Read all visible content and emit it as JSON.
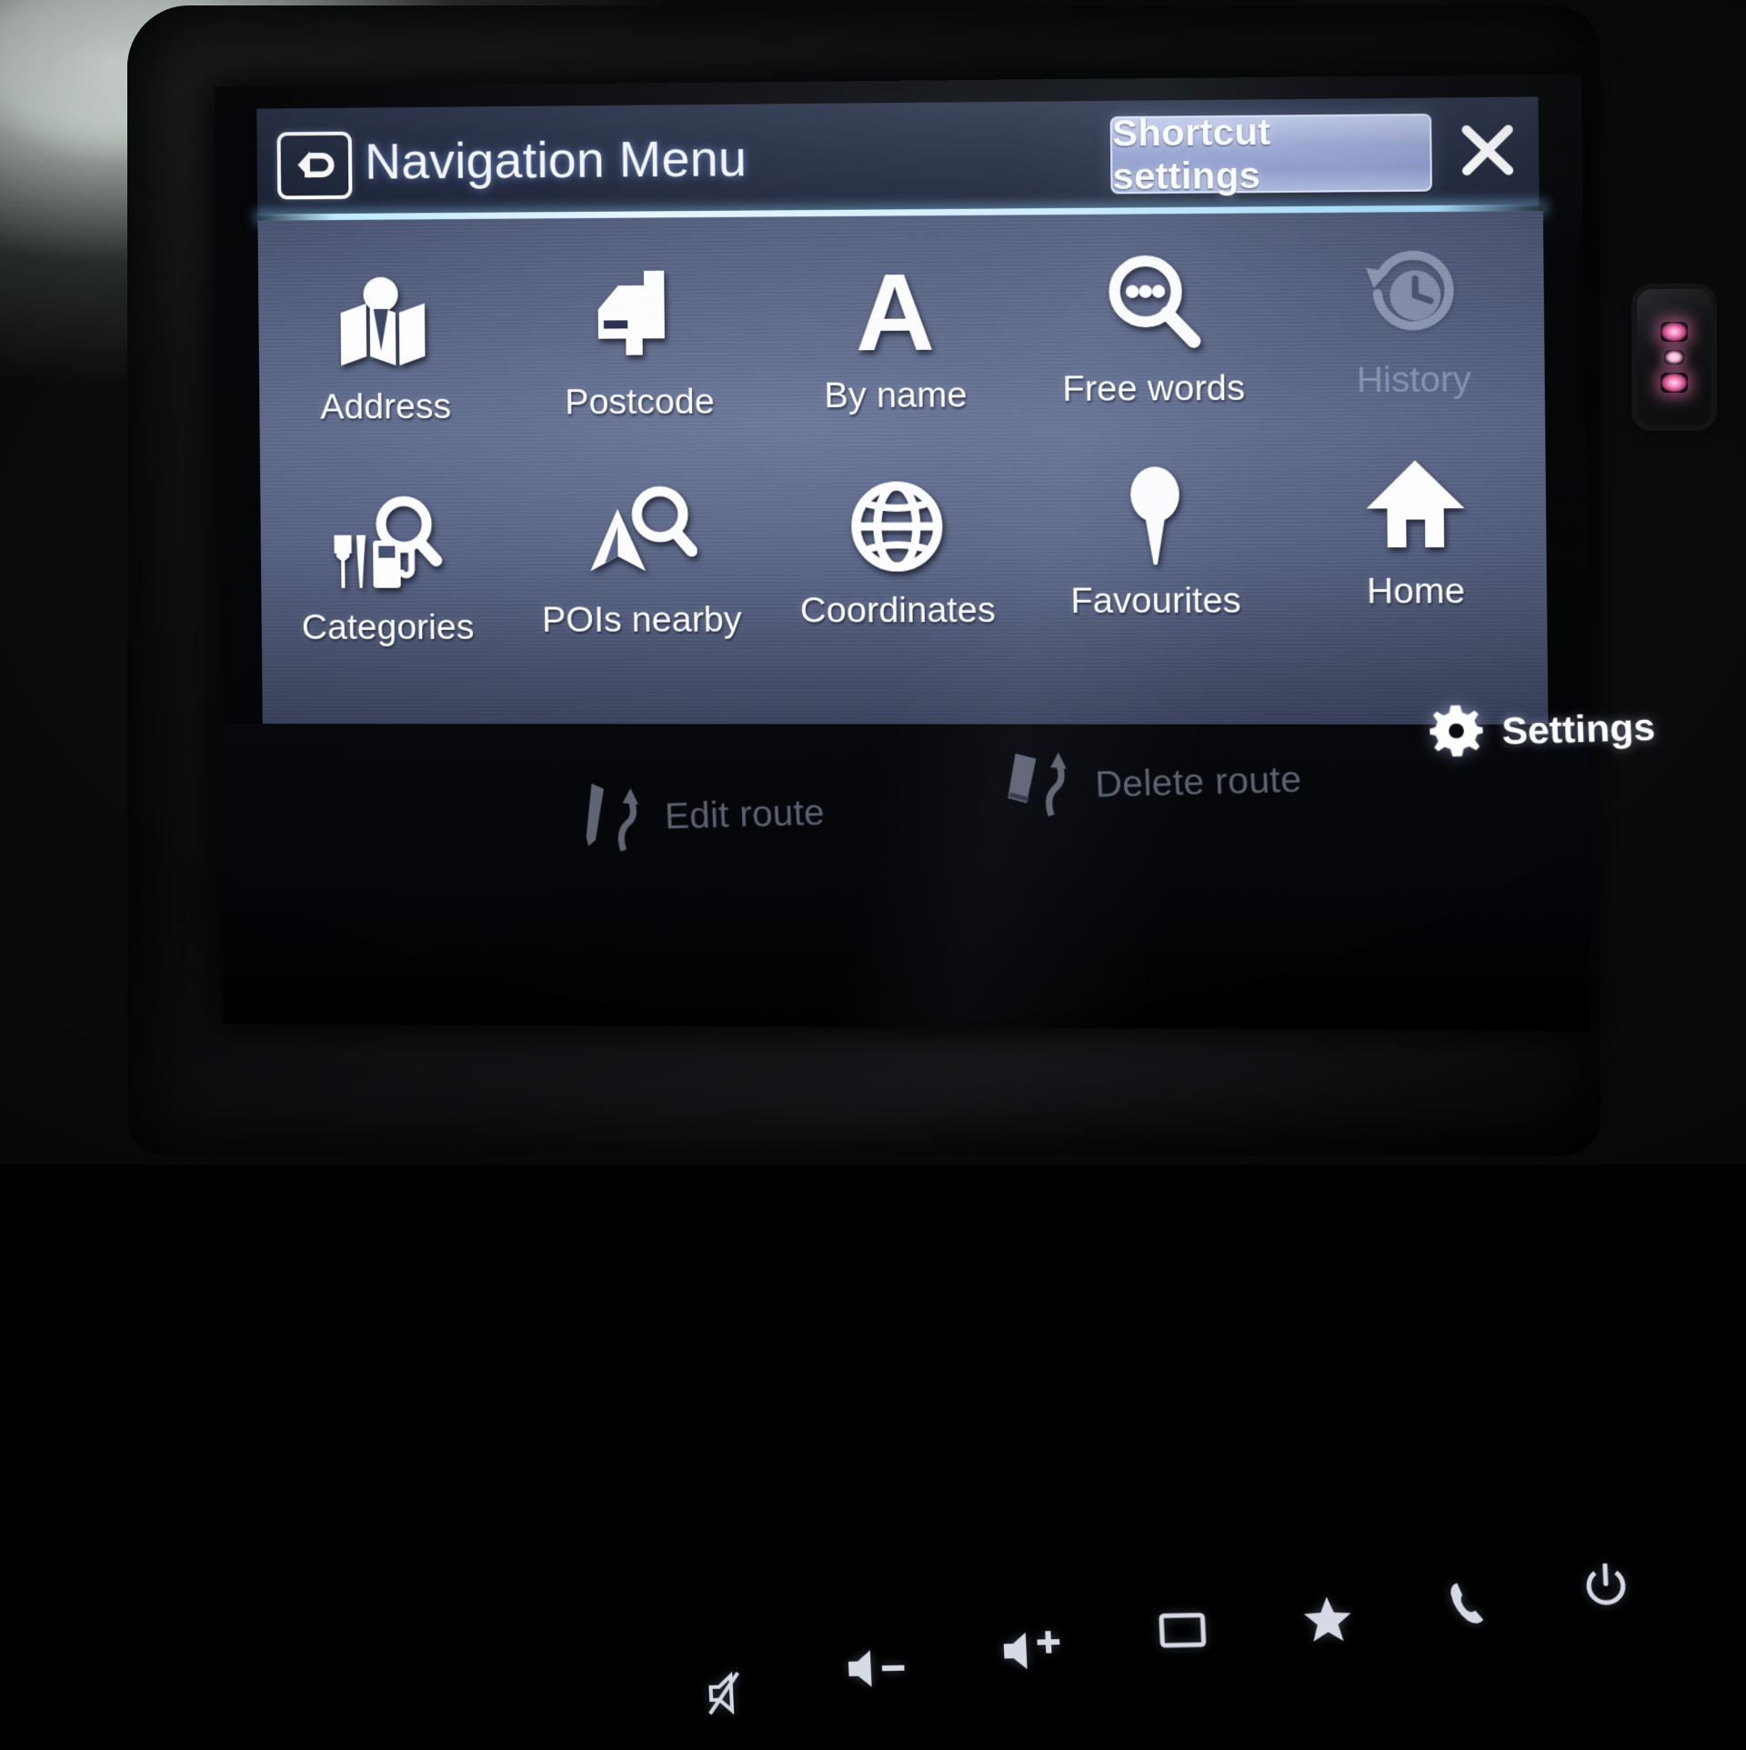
{
  "device": {
    "type": "car-infotainment-touchscreen",
    "accent_color": "#bfeaff",
    "panel_color": "#556081",
    "text_color": "#ffffff",
    "disabled_color": "#9aa3bd"
  },
  "header": {
    "back_icon": "back-arrow-icon",
    "title": "Navigation Menu",
    "shortcut_label": "Shortcut settings",
    "close_icon": "close-icon"
  },
  "menu": {
    "row1": [
      {
        "label": "Address",
        "icon": "map-person-icon",
        "enabled": true
      },
      {
        "label": "Postcode",
        "icon": "mailbox-icon",
        "enabled": true
      },
      {
        "label": "By name",
        "icon": "letter-a-icon",
        "enabled": true
      },
      {
        "label": "Free words",
        "icon": "magnifier-dots-icon",
        "enabled": true
      },
      {
        "label": "History",
        "icon": "clock-history-icon",
        "enabled": false
      }
    ],
    "row2": [
      {
        "label": "Categories",
        "icon": "cutlery-fuel-magnifier-icon",
        "enabled": true
      },
      {
        "label": "POIs nearby",
        "icon": "navarrow-magnifier-icon",
        "enabled": true
      },
      {
        "label": "Coordinates",
        "icon": "globe-icon",
        "enabled": true
      },
      {
        "label": "Favourites",
        "icon": "map-pin-icon",
        "enabled": true
      },
      {
        "label": "Home",
        "icon": "house-icon",
        "enabled": true
      }
    ]
  },
  "bottom_bar": {
    "edit_route": {
      "label": "Edit route",
      "icon": "pencil-route-icon",
      "enabled": false
    },
    "delete_route": {
      "label": "Delete route",
      "icon": "eraser-route-icon",
      "enabled": false
    },
    "settings": {
      "label": "Settings",
      "icon": "gear-icon",
      "enabled": true
    }
  },
  "hardware_buttons": [
    {
      "name": "mute",
      "icon": "speaker-mute-icon"
    },
    {
      "name": "volume-down",
      "icon": "speaker-minus-icon"
    },
    {
      "name": "volume-up",
      "icon": "speaker-plus-icon"
    },
    {
      "name": "screen",
      "icon": "display-rectangle-icon"
    },
    {
      "name": "favourite",
      "icon": "star-icon"
    },
    {
      "name": "phone",
      "icon": "phone-handset-icon"
    },
    {
      "name": "power",
      "icon": "power-icon"
    }
  ]
}
